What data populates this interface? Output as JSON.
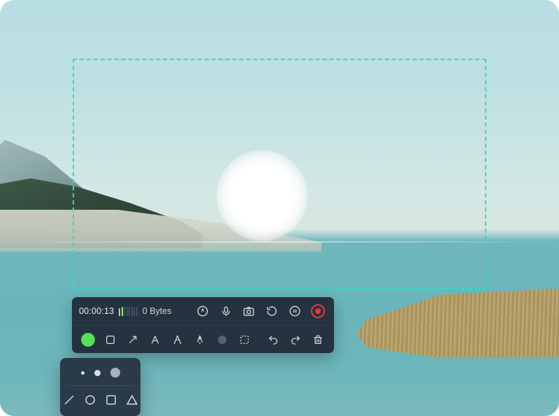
{
  "capture": {
    "selection_border_color": "#25e3c7"
  },
  "toolbar": {
    "timer": "00:00:13",
    "filesize": "0 Bytes",
    "audio_level_bars": 8,
    "audio_level_active": 2,
    "controls": {
      "cursor_label": "cursor",
      "microphone_label": "microphone",
      "camera_label": "camera",
      "restart_label": "restart",
      "pause_label": "pause",
      "record_label": "record"
    },
    "tools": {
      "color": "#59e05a",
      "rectangle": "rectangle",
      "arrow": "arrow",
      "text": "text",
      "highlighter": "highlighter",
      "pen": "pen",
      "eraser": "eraser",
      "marquee": "marquee",
      "undo": "undo",
      "redo": "redo",
      "delete": "delete"
    }
  },
  "popover": {
    "sizes": [
      "small",
      "medium",
      "large"
    ],
    "shapes": [
      "line",
      "circle",
      "square",
      "triangle"
    ]
  }
}
